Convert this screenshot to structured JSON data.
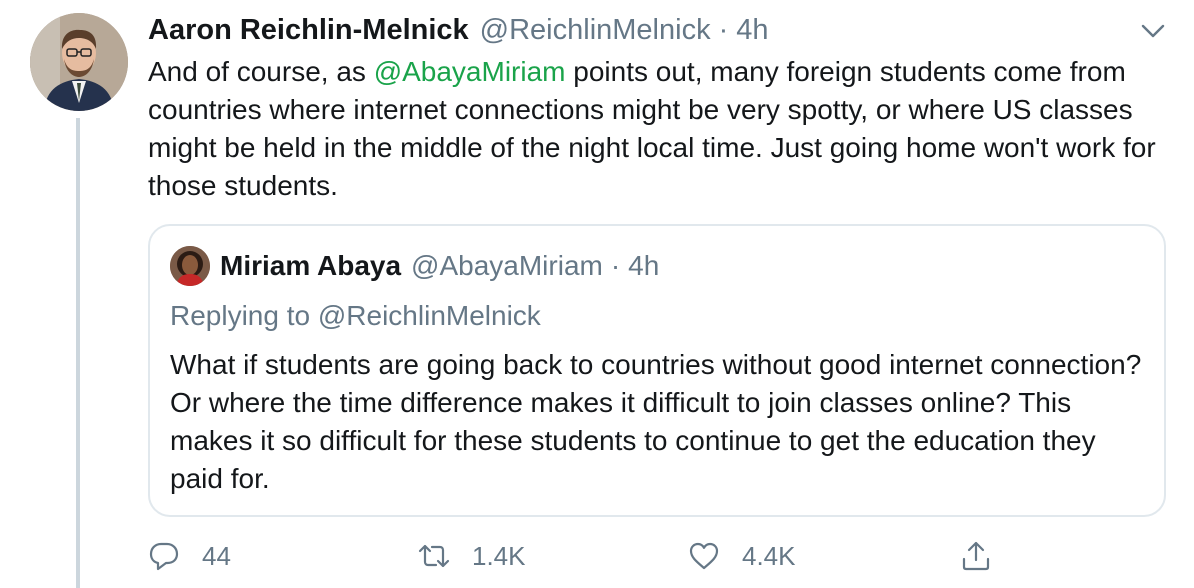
{
  "tweet": {
    "author_name": "Aaron Reichlin-Melnick",
    "author_handle": "@ReichlinMelnick",
    "separator": "·",
    "time": "4h",
    "text_before_mention": "And of course, as ",
    "mention": "@AbayaMiriam",
    "text_after_mention": " points out, many foreign students come from countries where internet connections might be very spotty, or where US classes might be held in the middle of the night local time. Just going home won't work for those students.",
    "menu_icon": "chevron-down-icon"
  },
  "quote": {
    "author_name": "Miriam Abaya",
    "author_handle": "@AbayaMiriam",
    "separator": "·",
    "time": "4h",
    "replying_to": "Replying to @ReichlinMelnick",
    "text": "What if students are going back to countries without good internet connection? Or where the time difference makes it difficult to join classes online? This makes it so difficult for these students to continue to get the education they paid for."
  },
  "actions": {
    "reply_count": "44",
    "retweet_count": "1.4K",
    "like_count": "4.4K",
    "icons": [
      "reply-icon",
      "retweet-icon",
      "like-icon",
      "share-icon"
    ]
  },
  "colors": {
    "text": "#14171a",
    "secondary": "#657786",
    "mention": "#1aa34a",
    "border": "#e1e8ed",
    "thread_line": "#ccd6dd"
  }
}
